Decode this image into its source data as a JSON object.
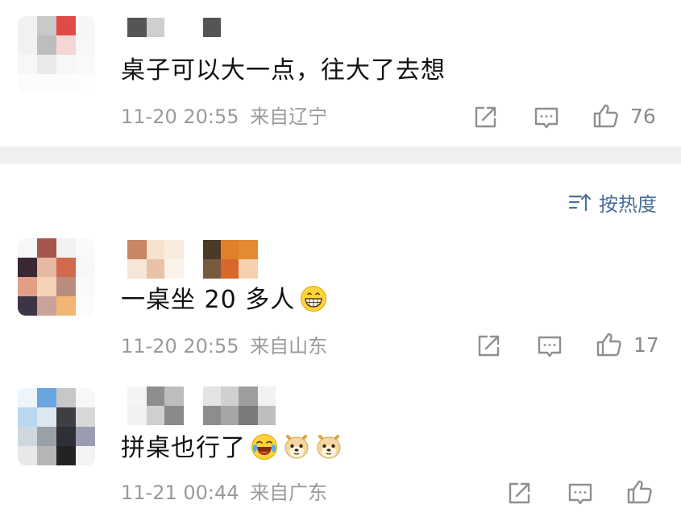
{
  "comments": [
    {
      "text": "桌子可以大一点，往大了去想",
      "time": "11-20 20:55",
      "location": "来自辽宁",
      "likes": "76"
    },
    {
      "text": "一桌坐 20 多人",
      "time": "11-20 20:55",
      "location": "来自山东",
      "likes": "17",
      "emojis": [
        "grin-emoji"
      ]
    },
    {
      "text": "拼桌也行了",
      "time": "11-21 00:44",
      "location": "来自广东",
      "likes": "",
      "emojis": [
        "laugh-cry-emoji",
        "doge-emoji",
        "doge-emoji"
      ]
    }
  ],
  "sort": {
    "label": "按热度"
  },
  "icons": [
    "share-icon",
    "comment-icon",
    "like-icon",
    "sort-icon"
  ],
  "colors": {
    "meta_text": "#9a9a9a",
    "sort_link": "#4a6f9a",
    "divider": "#f0f0f0"
  }
}
